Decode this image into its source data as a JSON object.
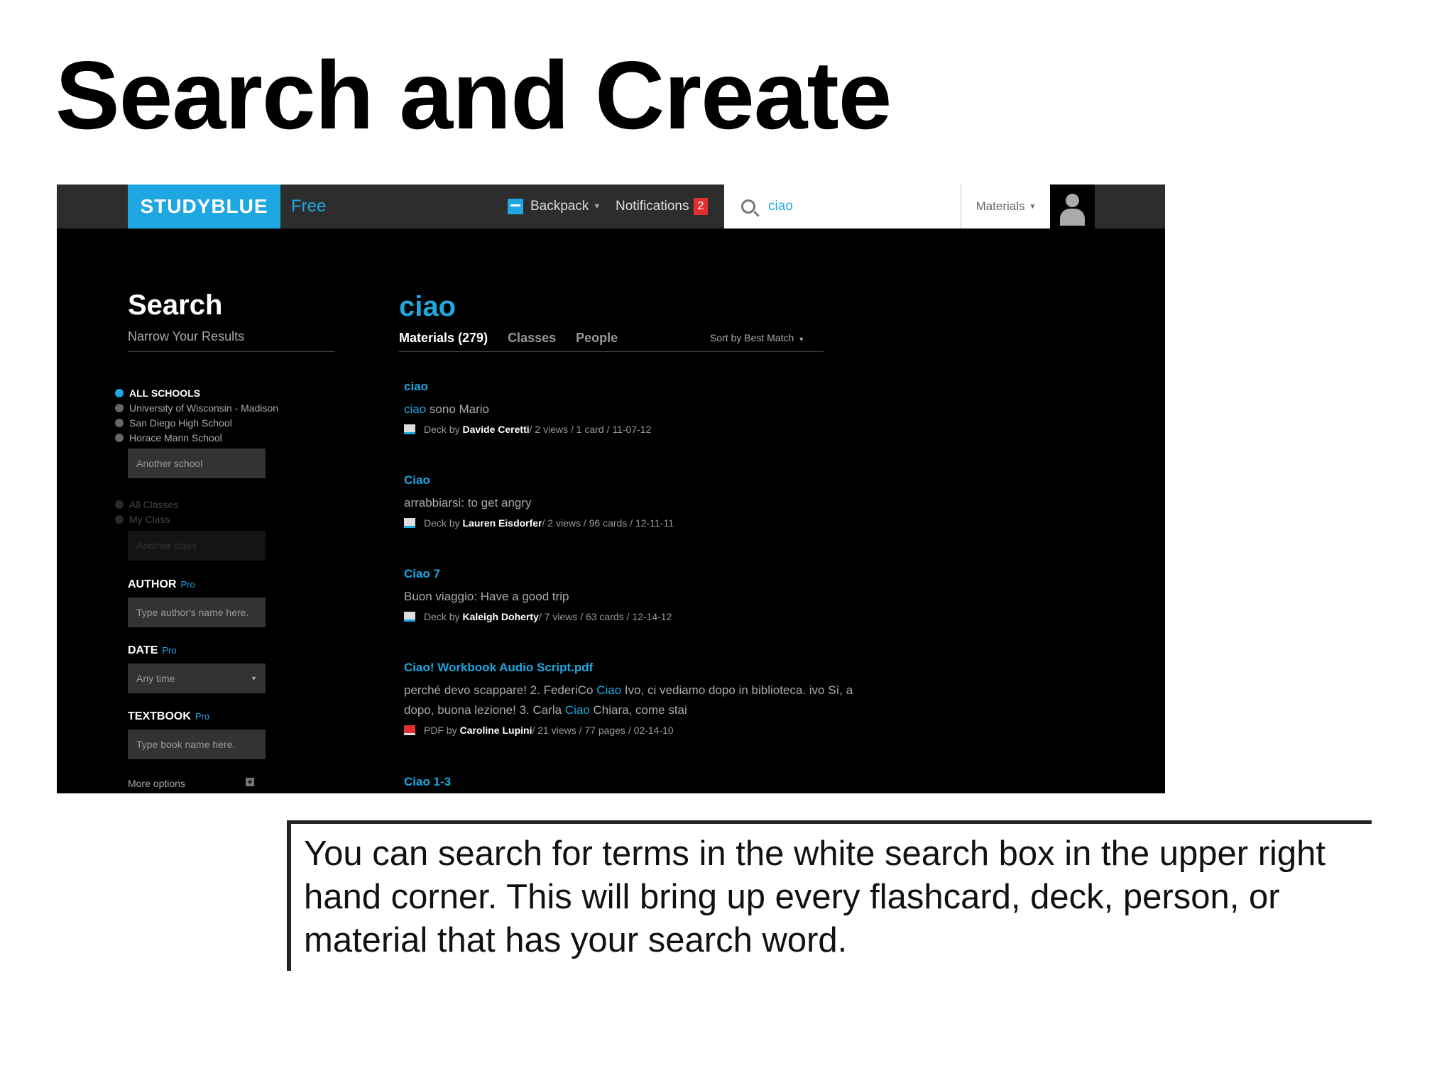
{
  "slide": {
    "title": "Search and Create",
    "caption": "You can search for terms in the white search box in the upper right hand corner. This will bring up every flashcard, deck, person, or material that has your search word."
  },
  "nav": {
    "logo": "STUDYBLUE",
    "plan": "Free",
    "backpack": "Backpack",
    "notifications": "Notifications",
    "notification_count": "2",
    "search_value": "ciao",
    "materials_dropdown": "Materials"
  },
  "sidebar": {
    "heading": "Search",
    "subheading": "Narrow Your Results",
    "schools": [
      {
        "label": "ALL SCHOOLS",
        "selected": true
      },
      {
        "label": "University of Wisconsin - Madison"
      },
      {
        "label": "San Diego High School"
      },
      {
        "label": "Horace Mann School"
      }
    ],
    "another_school_placeholder": "Another school",
    "classes": [
      {
        "label": "All Classes"
      },
      {
        "label": "My Class"
      }
    ],
    "another_class_placeholder": "Another class",
    "author_label": "AUTHOR",
    "author_placeholder": "Type author's name here.",
    "date_label": "DATE",
    "date_value": "Any time",
    "textbook_label": "TEXTBOOK",
    "textbook_placeholder": "Type book name here.",
    "pro_tag": "Pro",
    "more_options": "More options"
  },
  "results": {
    "query": "ciao",
    "tabs": [
      "Materials (279)",
      "Classes",
      "People"
    ],
    "sort": "Sort by Best Match",
    "items": [
      {
        "title": "ciao",
        "snippet_hl": "ciao",
        "snippet": " sono Mario",
        "type": "Deck",
        "author": "Davide Ceretti",
        "stats": " / 2 views / 1 card / 11-07-12"
      },
      {
        "title": "Ciao",
        "snippet": "arrabbiarsi: to get angry",
        "type": "Deck",
        "author": "Lauren Eisdorfer",
        "stats": " / 2 views / 96 cards / 12-11-11"
      },
      {
        "title": "Ciao 7",
        "snippet": "Buon viaggio: Have a good trip",
        "type": "Deck",
        "author": "Kaleigh Doherty",
        "stats": " / 7 views / 63 cards / 12-14-12"
      },
      {
        "title": "Ciao! Workbook Audio Script.pdf",
        "snippet_parts": [
          "perché devo scappare! 2. FederiCo ",
          "Ciao",
          " Ivo, ci vediamo dopo in biblioteca. ivo Sì, a dopo, buona lezione! 3. Carla ",
          "Ciao",
          " Chiara, come stai"
        ],
        "type": "PDF",
        "author": "Caroline Lupini",
        "stats": " / 21 views / 77 pages / 02-14-10"
      },
      {
        "title": "Ciao 1-3"
      }
    ],
    "by_word": "by"
  },
  "colors": {
    "brand": "#1ea7e0",
    "badge": "#e03030"
  }
}
